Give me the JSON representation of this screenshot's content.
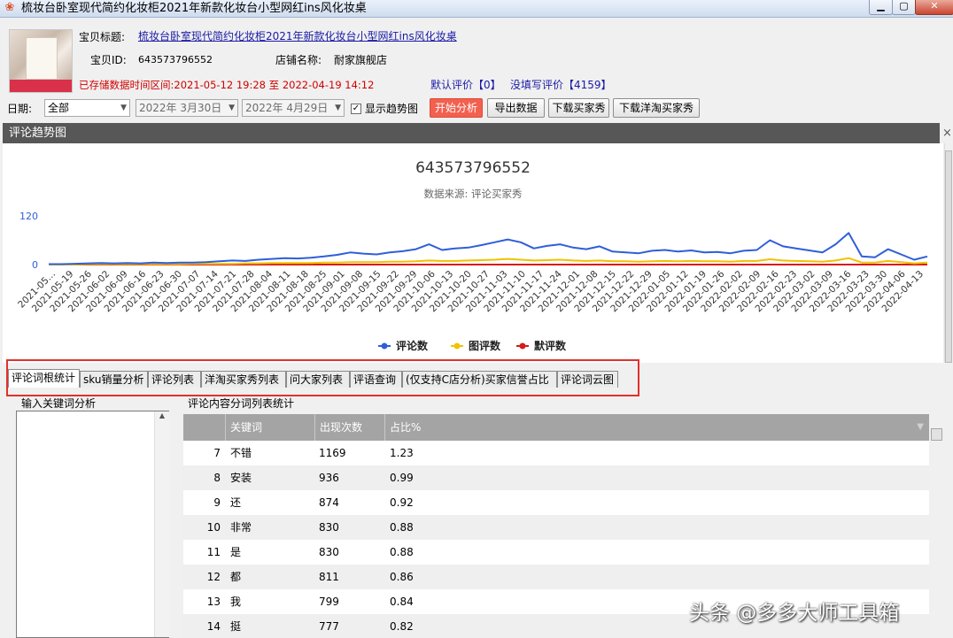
{
  "window": {
    "title": "梳妆台卧室现代简约化妆柜2021年新款化妆台小型网红ins风化妆桌",
    "minimize": "▁",
    "maximize": "▢",
    "close": "✕",
    "app_icon": "❀"
  },
  "product": {
    "title_label": "宝贝标题:",
    "title_value": "梳妆台卧室现代简约化妆柜2021年新款化妆台小型网红ins风化妆桌",
    "id_label": "宝贝ID:",
    "id_value": "643573796552",
    "shop_label": "店铺名称:",
    "shop_value": "耐家旗舰店",
    "stored_range": "已存储数据时间区间:2021-05-12 19:28 至 2022-04-19 14:12",
    "default_reviews": "默认评价【0】",
    "unfilled_reviews": "没填写评价【4159】"
  },
  "toolbar": {
    "date_label": "日期:",
    "date_select": "全部",
    "start_date": "2022年 3月30日",
    "end_date": "2022年 4月29日",
    "show_trend_label": "显示趋势图",
    "show_trend_checked": "✓",
    "start_btn": "开始分析",
    "export_btn": "导出数据",
    "download_buyer_btn": "下载买家秀",
    "download_foreign_btn": "下载洋淘买家秀"
  },
  "trend_panel": {
    "header": "评论趋势图",
    "close": "×"
  },
  "chart_data": {
    "type": "line",
    "title": "643573796552",
    "subtitle": "数据来源: 评论买家秀",
    "ylim": [
      0,
      120
    ],
    "y_ticks": [
      "120",
      "0"
    ],
    "x_tick_labels": [
      "2021-05…",
      "2021-05-19",
      "2021-05-26",
      "2021-06-02",
      "2021-06-09",
      "2021-06-16",
      "2021-06-23",
      "2021-06-30",
      "2021-07-07",
      "2021-07-14",
      "2021-07-21",
      "2021-07-28",
      "2021-08-04",
      "2021-08-11",
      "2021-08-18",
      "2021-08-25",
      "2021-09-01",
      "2021-09-08",
      "2021-09-15",
      "2021-09-22",
      "2021-09-29",
      "2021-10-06",
      "2021-10-13",
      "2021-10-20",
      "2021-10-27",
      "2021-11-03",
      "2021-11-10",
      "2021-11-17",
      "2021-11-24",
      "2021-12-01",
      "2021-12-08",
      "2021-12-15",
      "2021-12-22",
      "2021-12-29",
      "2022-01-05",
      "2022-01-12",
      "2022-01-19",
      "2022-01-26",
      "2022-02-02",
      "2022-02-09",
      "2022-02-16",
      "2022-02-23",
      "2022-03-02",
      "2022-03-09",
      "2022-03-16",
      "2022-03-23",
      "2022-03-30",
      "2022-04-06",
      "2022-04-13"
    ],
    "series": [
      {
        "name": "评论数",
        "color": "#2f5fd8",
        "values": [
          1,
          1,
          2,
          3,
          4,
          3,
          4,
          3,
          5,
          4,
          5,
          5,
          6,
          8,
          10,
          9,
          12,
          14,
          16,
          15,
          17,
          20,
          24,
          30,
          27,
          25,
          30,
          33,
          38,
          50,
          36,
          40,
          42,
          48,
          55,
          62,
          55,
          40,
          46,
          50,
          42,
          38,
          45,
          32,
          30,
          28,
          34,
          36,
          32,
          35,
          30,
          31,
          28,
          34,
          36,
          60,
          45,
          40,
          35,
          30,
          50,
          78,
          20,
          18,
          38,
          25,
          12,
          20
        ]
      },
      {
        "name": "图评数",
        "color": "#f2c100",
        "values": [
          0,
          0,
          0,
          1,
          1,
          1,
          1,
          1,
          1,
          1,
          1,
          2,
          2,
          2,
          2,
          3,
          3,
          4,
          4,
          4,
          4,
          5,
          5,
          6,
          6,
          6,
          7,
          7,
          8,
          10,
          9,
          9,
          10,
          11,
          12,
          14,
          12,
          10,
          11,
          12,
          10,
          9,
          10,
          8,
          8,
          7,
          8,
          9,
          8,
          9,
          8,
          8,
          7,
          9,
          9,
          13,
          10,
          9,
          8,
          7,
          10,
          16,
          5,
          5,
          9,
          6,
          3,
          5
        ]
      },
      {
        "name": "默评数",
        "color": "#d61b1b",
        "values": [
          0,
          0,
          0,
          0,
          0,
          0,
          0,
          0,
          0,
          0,
          0,
          0,
          0,
          0,
          0,
          0,
          0,
          0,
          0,
          0,
          0,
          0,
          0,
          0,
          0,
          0,
          0,
          0,
          0,
          0,
          0,
          0,
          0,
          0,
          0,
          0,
          0,
          0,
          0,
          0,
          0,
          0,
          0,
          0,
          0,
          0,
          0,
          0,
          0,
          0,
          0,
          0,
          0,
          0,
          0,
          0,
          0,
          0,
          0,
          0,
          0,
          0,
          0,
          0,
          0,
          0,
          0,
          0
        ]
      }
    ],
    "legend_position": "bottom-center"
  },
  "tabs": [
    {
      "label": "评论词根统计"
    },
    {
      "label": "sku销量分析"
    },
    {
      "label": "评论列表"
    },
    {
      "label": "洋淘买家秀列表"
    },
    {
      "label": "问大家列表"
    },
    {
      "label": "评语查询"
    },
    {
      "label": "(仅支持C店分析)买家信誉占比"
    },
    {
      "label": "评论词云图"
    }
  ],
  "keyword_group": {
    "title": "输入关键词分析"
  },
  "stats_table": {
    "title": "评论内容分词列表统计",
    "columns": [
      "关键词",
      "出现次数",
      "占比%"
    ],
    "rows": [
      {
        "idx": "7",
        "word": "不错",
        "count": "1169",
        "pct": "1.23"
      },
      {
        "idx": "8",
        "word": "安装",
        "count": "936",
        "pct": "0.99"
      },
      {
        "idx": "9",
        "word": "还",
        "count": "874",
        "pct": "0.92"
      },
      {
        "idx": "10",
        "word": "非常",
        "count": "830",
        "pct": "0.88"
      },
      {
        "idx": "11",
        "word": "是",
        "count": "830",
        "pct": "0.88"
      },
      {
        "idx": "12",
        "word": "都",
        "count": "811",
        "pct": "0.86"
      },
      {
        "idx": "13",
        "word": "我",
        "count": "799",
        "pct": "0.84"
      },
      {
        "idx": "14",
        "word": "挺",
        "count": "777",
        "pct": "0.82"
      }
    ]
  },
  "watermark": "头条 @多多大师工具箱"
}
